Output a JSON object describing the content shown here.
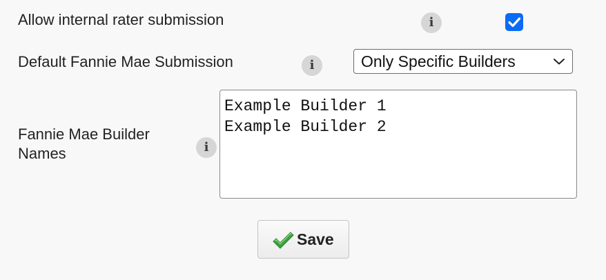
{
  "settings": {
    "internal_rater": {
      "label": "Allow internal rater submission",
      "info_glyph": "i",
      "checked": true
    },
    "fannie_mae_submission": {
      "label": "Default Fannie Mae Submission",
      "info_glyph": "i",
      "selected_value": "Only Specific Builders"
    },
    "builder_names": {
      "label_line1": "Fannie Mae Builder",
      "label_line2": "Names",
      "info_glyph": "i",
      "lines": [
        "Example Builder 1",
        "Example Builder 2"
      ]
    }
  },
  "actions": {
    "save_label": "Save"
  },
  "icons": {
    "info": "info-icon",
    "check": "checkmark-icon",
    "chevron": "chevron-down-icon",
    "save": "green-check-icon"
  },
  "colors": {
    "checkbox_accent": "#0a6cf5",
    "save_check_green": "#3aa33a",
    "info_bg": "#d6d6d6",
    "page_bg": "#f8f8f8"
  }
}
